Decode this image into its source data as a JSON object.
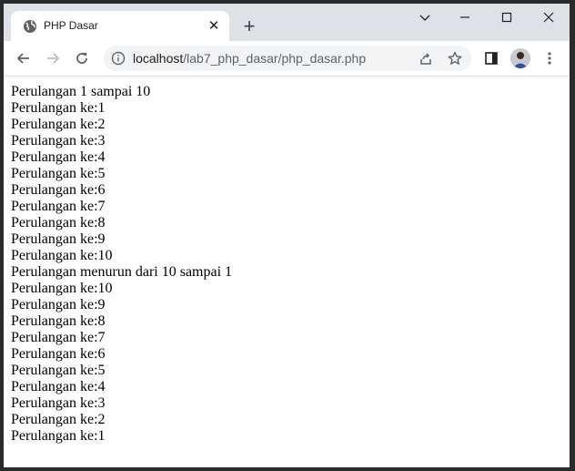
{
  "tab": {
    "title": "PHP Dasar"
  },
  "omnibox": {
    "host": "localhost",
    "path": "/lab7_php_dasar/php_dasar.php"
  },
  "page": {
    "lines": [
      "Perulangan 1 sampai 10",
      "Perulangan ke:1",
      "Perulangan ke:2",
      "Perulangan ke:3",
      "Perulangan ke:4",
      "Perulangan ke:5",
      "Perulangan ke:6",
      "Perulangan ke:7",
      "Perulangan ke:8",
      "Perulangan ke:9",
      "Perulangan ke:10",
      "Perulangan menurun dari 10 sampai 1",
      "Perulangan ke:10",
      "Perulangan ke:9",
      "Perulangan ke:8",
      "Perulangan ke:7",
      "Perulangan ke:6",
      "Perulangan ke:5",
      "Perulangan ke:4",
      "Perulangan ke:3",
      "Perulangan ke:2",
      "Perulangan ke:1"
    ]
  },
  "icons": {
    "tab_favicon": "globe-icon",
    "tab_close": "close-icon",
    "new_tab": "plus-icon",
    "back": "back-arrow-icon",
    "forward": "forward-arrow-icon",
    "reload": "reload-icon",
    "site_info": "info-icon",
    "share": "share-icon",
    "bookmark": "star-icon",
    "side_panel": "side-panel-icon",
    "profile": "avatar",
    "menu": "kebab-menu-icon"
  },
  "colors": {
    "tabstrip": "#dee1e6",
    "omnibox": "#f1f3f4",
    "frame": "#2b2b2b"
  }
}
